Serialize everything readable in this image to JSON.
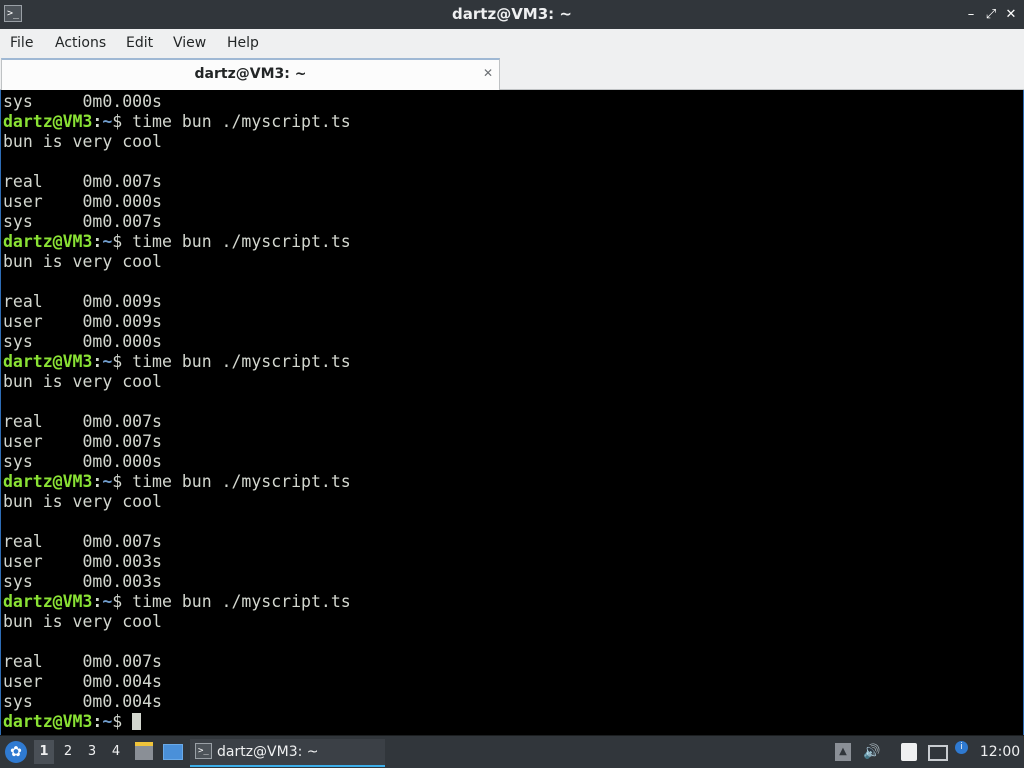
{
  "window": {
    "title": "dartz@VM3: ~",
    "app_icon": "terminal-icon",
    "app_icon_glyph": ">_",
    "controls": {
      "minimize": "–",
      "maximize": "⤢",
      "close": "✕"
    }
  },
  "menu": {
    "items": [
      "File",
      "Actions",
      "Edit",
      "View",
      "Help"
    ]
  },
  "tabs": [
    {
      "label": "dartz@VM3: ~",
      "active": true,
      "close_glyph": "✕"
    }
  ],
  "terminal": {
    "prompt": {
      "user_host": "dartz@VM3",
      "separator": ":",
      "path": "~",
      "symbol": "$ "
    },
    "lines": [
      {
        "kind": "output",
        "text": "sys\t0m0.000s"
      },
      {
        "kind": "prompt",
        "cmd": "time bun ./myscript.ts"
      },
      {
        "kind": "output",
        "text": "bun is very cool"
      },
      {
        "kind": "output",
        "text": ""
      },
      {
        "kind": "output",
        "text": "real\t0m0.007s"
      },
      {
        "kind": "output",
        "text": "user\t0m0.000s"
      },
      {
        "kind": "output",
        "text": "sys\t0m0.007s"
      },
      {
        "kind": "prompt",
        "cmd": "time bun ./myscript.ts"
      },
      {
        "kind": "output",
        "text": "bun is very cool"
      },
      {
        "kind": "output",
        "text": ""
      },
      {
        "kind": "output",
        "text": "real\t0m0.009s"
      },
      {
        "kind": "output",
        "text": "user\t0m0.009s"
      },
      {
        "kind": "output",
        "text": "sys\t0m0.000s"
      },
      {
        "kind": "prompt",
        "cmd": "time bun ./myscript.ts"
      },
      {
        "kind": "output",
        "text": "bun is very cool"
      },
      {
        "kind": "output",
        "text": ""
      },
      {
        "kind": "output",
        "text": "real\t0m0.007s"
      },
      {
        "kind": "output",
        "text": "user\t0m0.007s"
      },
      {
        "kind": "output",
        "text": "sys\t0m0.000s"
      },
      {
        "kind": "prompt",
        "cmd": "time bun ./myscript.ts"
      },
      {
        "kind": "output",
        "text": "bun is very cool"
      },
      {
        "kind": "output",
        "text": ""
      },
      {
        "kind": "output",
        "text": "real\t0m0.007s"
      },
      {
        "kind": "output",
        "text": "user\t0m0.003s"
      },
      {
        "kind": "output",
        "text": "sys\t0m0.003s"
      },
      {
        "kind": "prompt",
        "cmd": "time bun ./myscript.ts"
      },
      {
        "kind": "output",
        "text": "bun is very cool"
      },
      {
        "kind": "output",
        "text": ""
      },
      {
        "kind": "output",
        "text": "real\t0m0.007s"
      },
      {
        "kind": "output",
        "text": "user\t0m0.004s"
      },
      {
        "kind": "output",
        "text": "sys\t0m0.004s"
      },
      {
        "kind": "prompt",
        "cmd": "",
        "cursor": true
      }
    ]
  },
  "taskbar": {
    "start_icon": "start-menu-icon",
    "desktops": [
      "1",
      "2",
      "3",
      "4"
    ],
    "active_desktop": "1",
    "launchers": [
      "file-manager-icon",
      "show-desktop-icon"
    ],
    "tasks": [
      {
        "label": "dartz@VM3: ~",
        "icon": "terminal-icon",
        "icon_glyph": ">_",
        "active": true
      }
    ],
    "tray": [
      "tray-expand-icon",
      "volume-icon",
      "clipboard-icon",
      "network-icon",
      "notification-icon"
    ],
    "clock": "12:00"
  },
  "colors": {
    "titlebar": "#31363b",
    "menubar": "#eff0f1",
    "terminal_bg": "#000000",
    "terminal_fg": "#d3d7cf",
    "prompt_user": "#8ae234",
    "prompt_path": "#729fcf",
    "accent": "#3daee9",
    "taskbar": "#31363b"
  }
}
